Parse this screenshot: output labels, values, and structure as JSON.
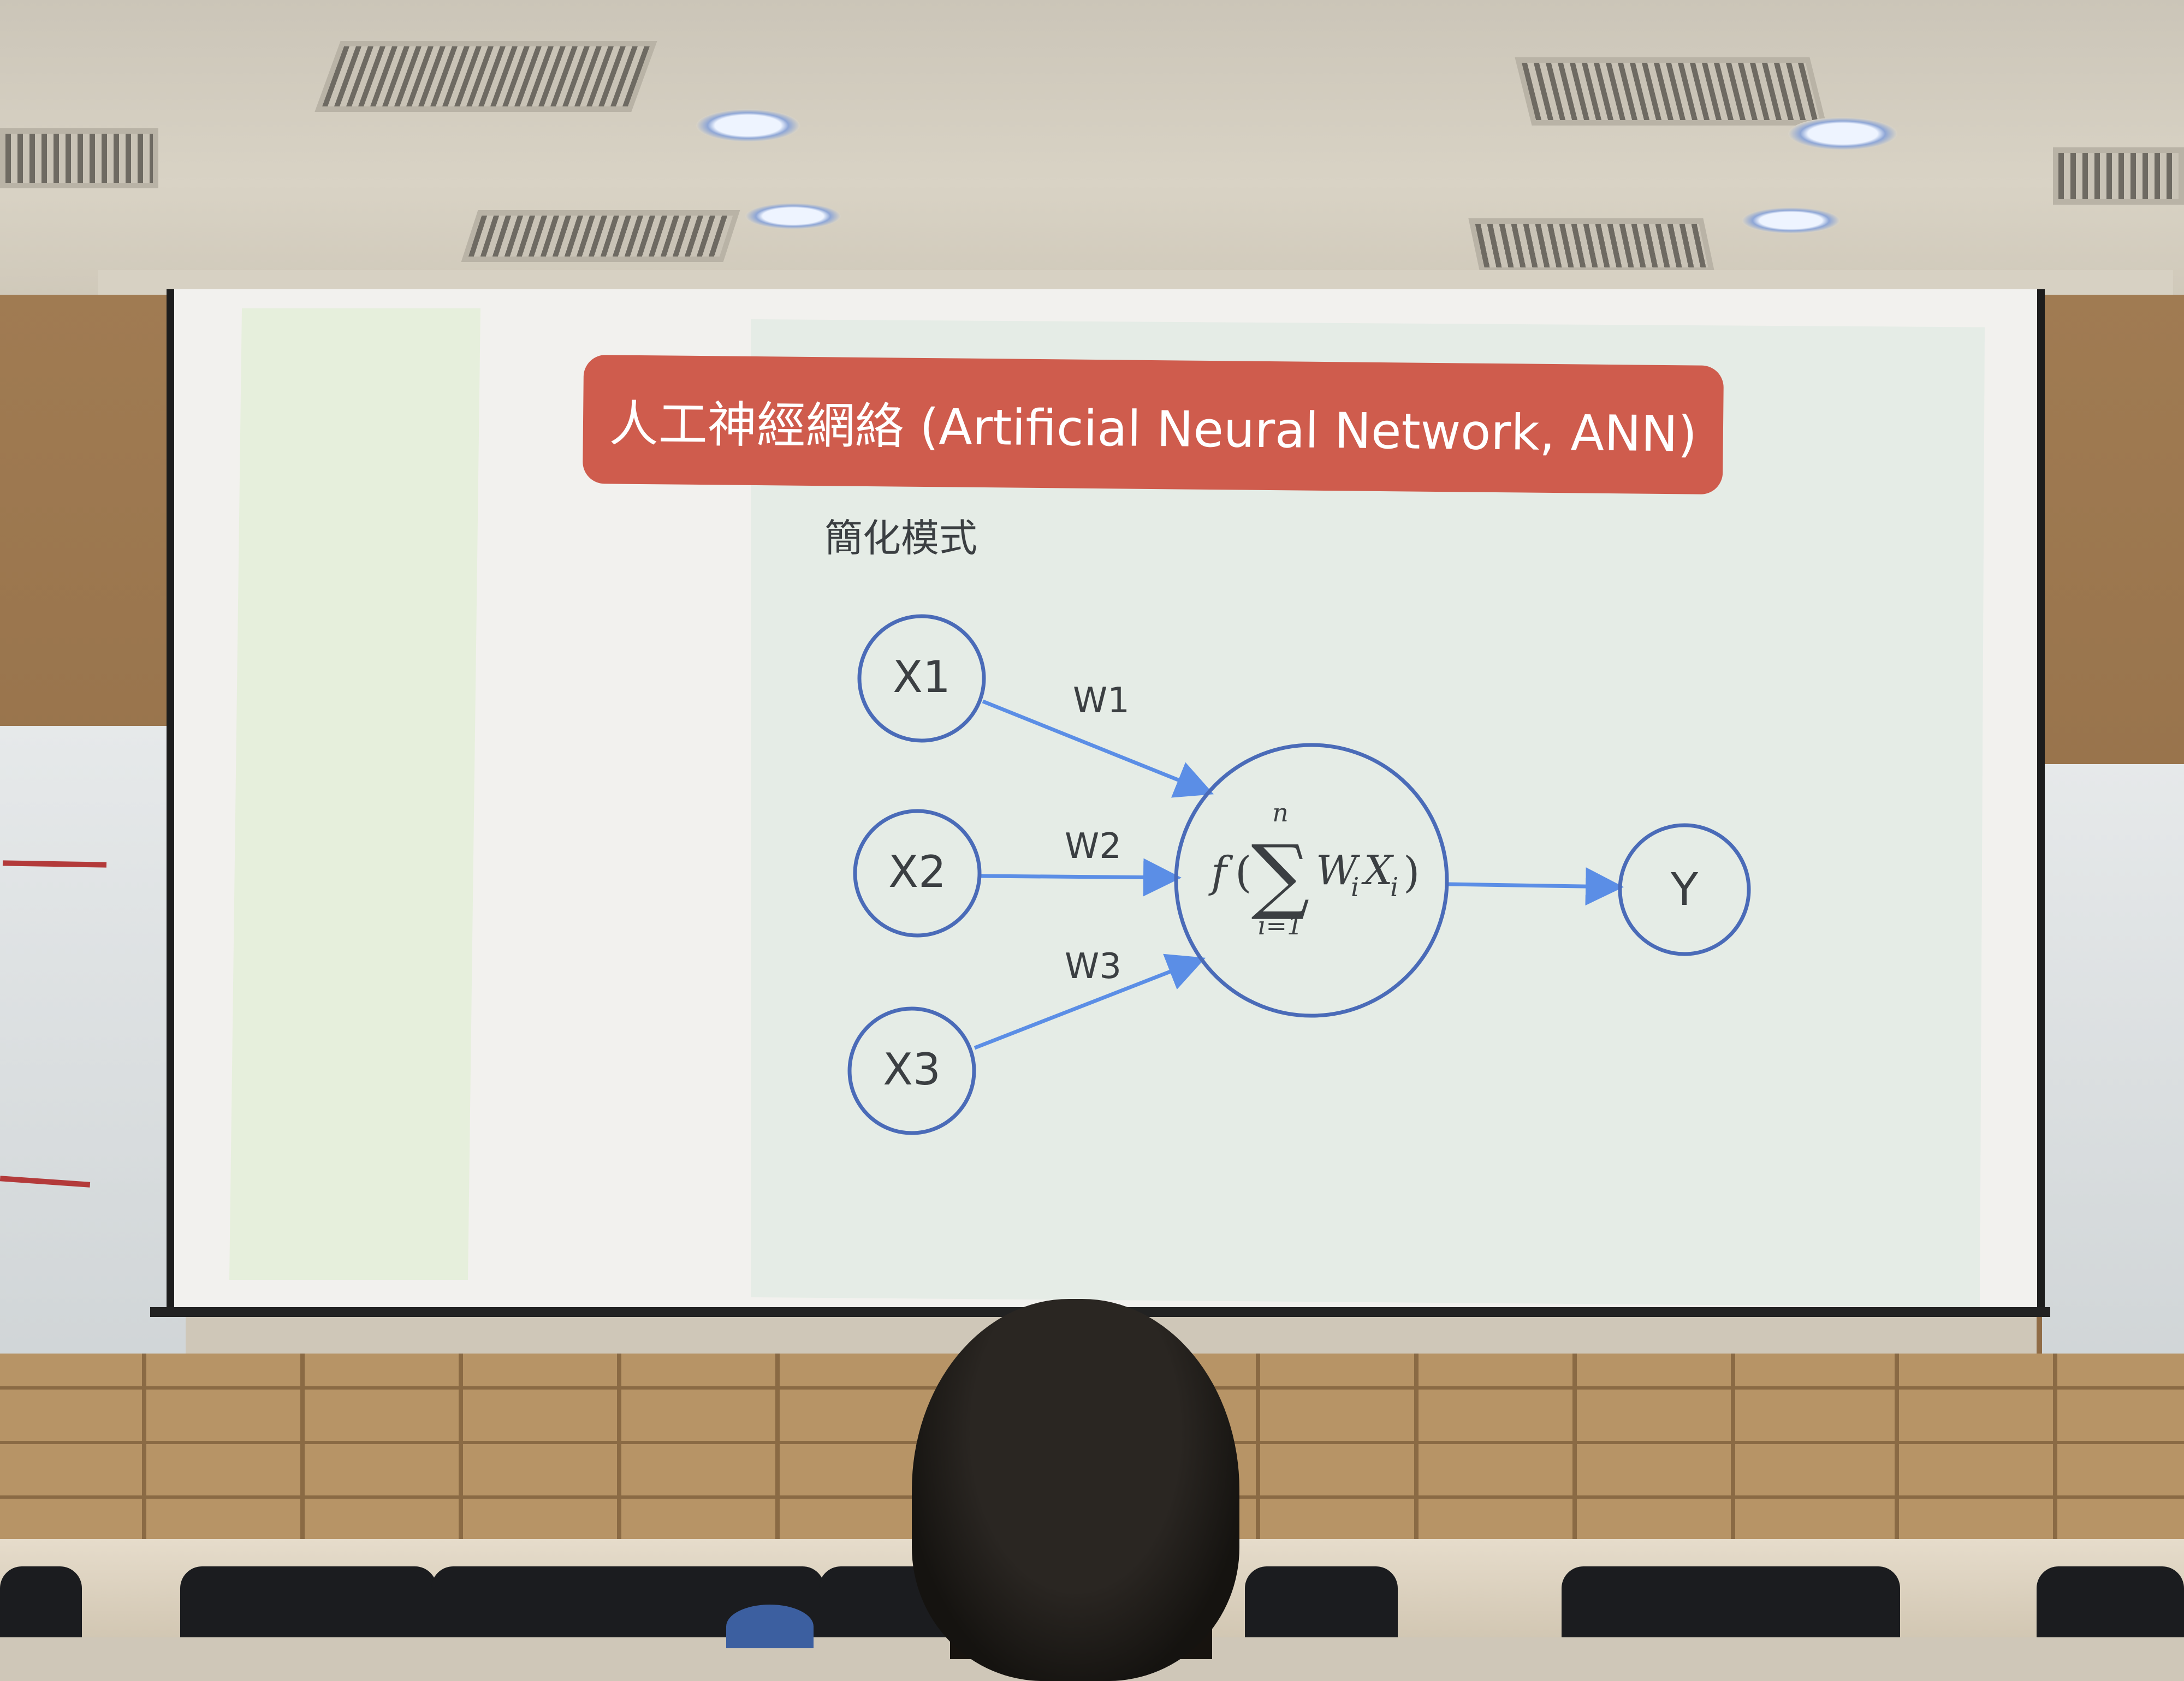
{
  "slide": {
    "title": "人工神經網絡 (Artificial Neural Network, ANN)",
    "subtitle": "簡化模式"
  },
  "diagram": {
    "inputs": [
      {
        "label": "X1",
        "weight": "W1"
      },
      {
        "label": "X2",
        "weight": "W2"
      },
      {
        "label": "X3",
        "weight": "W3"
      }
    ],
    "neuron": {
      "function": "f",
      "open_paren": "(",
      "close_paren": ")",
      "sum_symbol": "∑",
      "upper_limit": "n",
      "lower_limit": "i=1",
      "weight_var": "W",
      "input_var": "X",
      "index": "i"
    },
    "output": {
      "label": "Y"
    }
  },
  "colors": {
    "title_bar": "#cf5c4d",
    "circle_stroke": "#4a6bb8",
    "arrow": "#5b8ee6",
    "slide_bg": "#e5ece6"
  }
}
